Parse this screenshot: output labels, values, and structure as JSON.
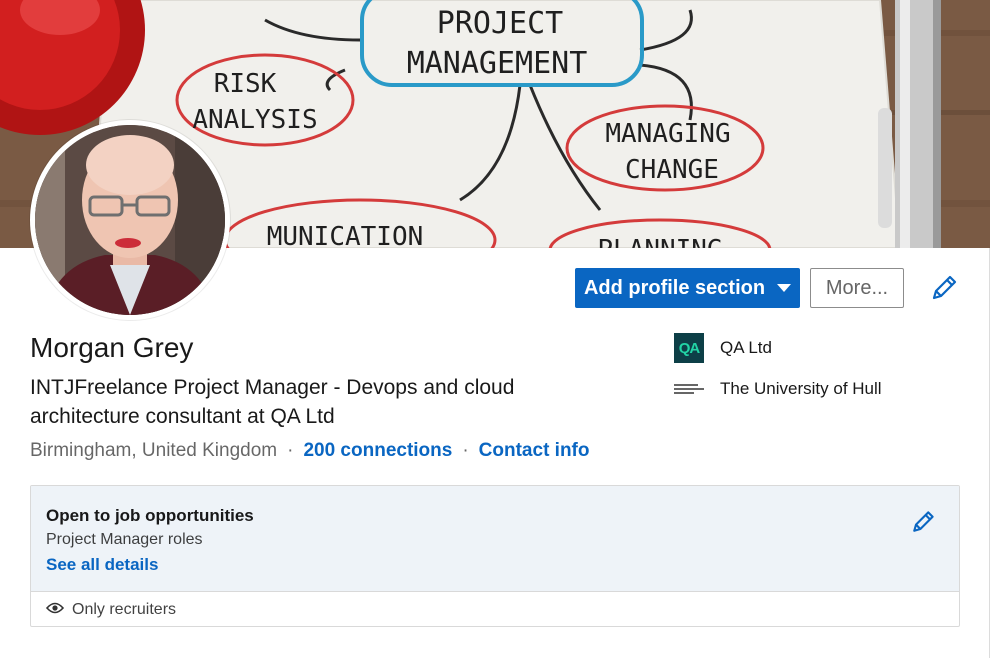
{
  "cover": {
    "texts": [
      "PROJECT",
      "MANAGEMENT",
      "RISK",
      "ANALYSIS",
      "MANAGING",
      "CHANGE",
      "MUNICATION",
      "PLANNING"
    ]
  },
  "profile": {
    "name": "Morgan Grey",
    "headline": "INTJFreelance Project Manager - Devops and cloud architecture consultant at QA Ltd",
    "location": "Birmingham, United Kingdom",
    "separator": "·",
    "connections": "200 connections",
    "contact_info": "Contact info"
  },
  "actions": {
    "add_section_label": "Add profile section",
    "more_label": "More..."
  },
  "orgs": {
    "company": "QA Ltd",
    "company_logo_text": "QA",
    "school": "The University of Hull"
  },
  "open_to_work": {
    "title": "Open to job opportunities",
    "subtitle": "Project Manager roles",
    "link": "See all details",
    "visibility": "Only recruiters"
  },
  "colors": {
    "primary": "#0a66c2",
    "box_bg": "#eef3f8"
  }
}
